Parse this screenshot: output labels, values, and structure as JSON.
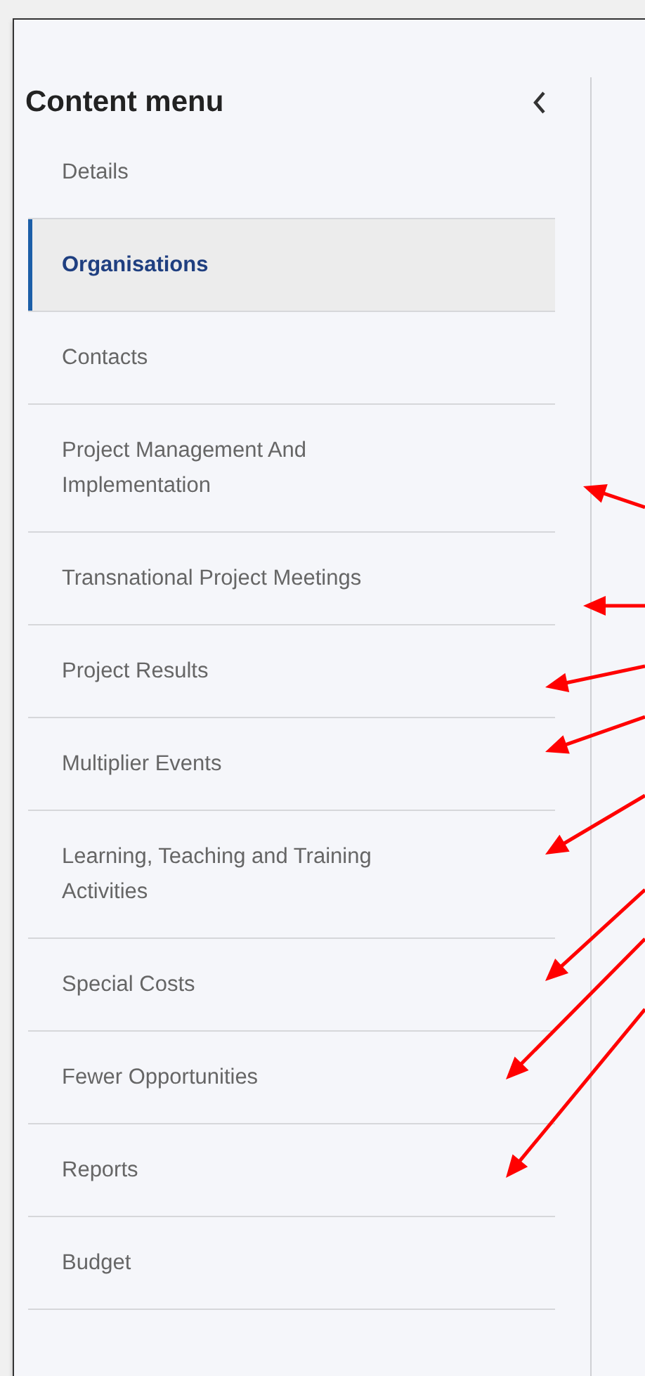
{
  "sidebar": {
    "title": "Content menu",
    "items": [
      {
        "label": "Details",
        "selected": false
      },
      {
        "label": "Organisations",
        "selected": true
      },
      {
        "label": "Contacts",
        "selected": false
      },
      {
        "label": "Project Management And Implementation",
        "selected": false
      },
      {
        "label": "Transnational Project Meetings",
        "selected": false
      },
      {
        "label": "Project Results",
        "selected": false
      },
      {
        "label": "Multiplier Events",
        "selected": false
      },
      {
        "label": "Learning, Teaching and Training Activities",
        "selected": false
      },
      {
        "label": "Special Costs",
        "selected": false
      },
      {
        "label": "Fewer Opportunities",
        "selected": false
      },
      {
        "label": "Reports",
        "selected": false
      },
      {
        "label": "Budget",
        "selected": false
      }
    ]
  }
}
